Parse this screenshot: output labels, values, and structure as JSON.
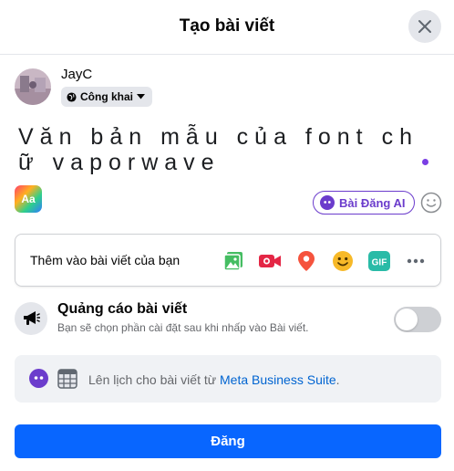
{
  "header": {
    "title": "Tạo bài viết",
    "close_icon": "close-icon"
  },
  "user": {
    "name": "JayC",
    "privacy_label": "Công khai"
  },
  "composer": {
    "text": "Văn bản mẫu của font chữ vaporwave"
  },
  "composer_tools": {
    "text_style_label": "Aa",
    "ai_post_label": "Bài Đăng AI",
    "emoji_icon": "smiley-icon"
  },
  "add_to_post": {
    "label": "Thêm vào bài viết của bạn",
    "icons": [
      "photo-video-icon",
      "live-video-icon",
      "location-pin-icon",
      "feeling-emoji-icon",
      "gif-icon",
      "more-icon"
    ],
    "gif_label": "GIF"
  },
  "boost": {
    "title": "Quảng cáo bài viết",
    "subtitle": "Bạn sẽ chọn phần cài đặt sau khi nhấp vào Bài viết.",
    "toggle_on": false
  },
  "schedule": {
    "text_prefix": "Lên lịch cho bài viết từ ",
    "link_label": "Meta Business Suite",
    "text_suffix": "."
  },
  "submit": {
    "label": "Đăng"
  },
  "colors": {
    "primary": "#0866ff",
    "ai_purple": "#6b3ccc",
    "link": "#0064d1"
  }
}
